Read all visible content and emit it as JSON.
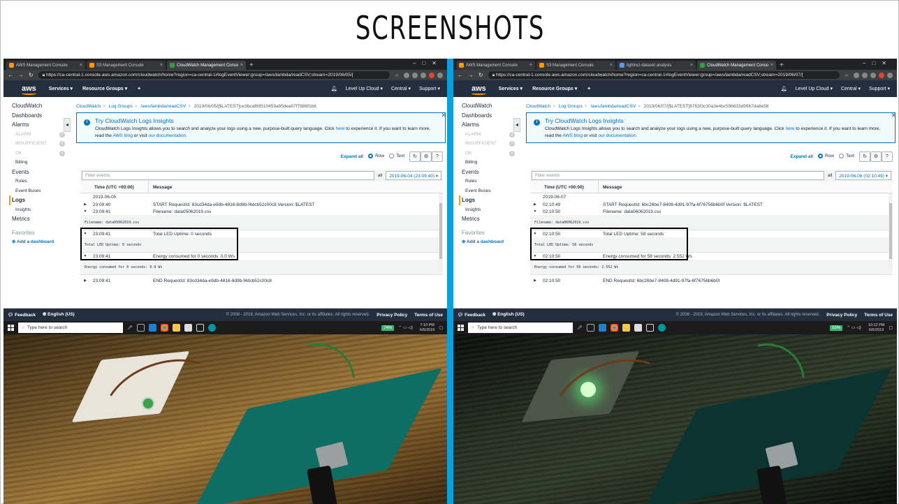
{
  "slide": {
    "title": "SCREENSHOTS"
  },
  "left": {
    "tabs": [
      {
        "label": "AWS Management Console",
        "active": false
      },
      {
        "label": "S3 Management Console",
        "active": false
      },
      {
        "label": "CloudWatch Management Conso",
        "active": true
      }
    ],
    "url": "https://ca-central-1.console.aws.amazon.com/cloudwatch/home?region=ca-central-1#logEventViewer:group=/aws/lambda/readCSV;stream=2019/06/05/[",
    "breadcrumb": {
      "cw": "CloudWatch",
      "lg": "Log Groups",
      "fn": "/aws/lambda/readCSV",
      "stream": "2019/06/05/[$LATEST]ce3bcaf69510459a95dea07f7886f1b6"
    },
    "date_filter": "2019-06-04 (23:09:40)",
    "date_row": "2019-06-05",
    "rows": [
      {
        "toggle": "▶",
        "time": "23:09:40",
        "msg": "START RequestId: 83cd34da-e9db-4816-8d9b-f4dcb52c00c8 Version: $LATEST"
      },
      {
        "toggle": "▼",
        "time": "23:09:41",
        "msg": "Filename: data05062019.csv"
      }
    ],
    "detail1": "Filename: data05062019.csv",
    "hl_row1": {
      "time": "23:09:41",
      "msg": "Total LED Uptime: 0 seconds"
    },
    "detail2": "Total LED Uptime: 0 seconds",
    "hl_row2": {
      "time": "23:09:41",
      "msg": "Energy consumed for 0 seconds: 0.0 Ws"
    },
    "detail3": "Energy consumed for 0 seconds: 0.0 Ws",
    "end_row": {
      "time": "23:09:41",
      "msg": "END RequestId: 83cd34da-e9db-4816-8d9b-f4dcb52c00c8"
    },
    "battery": "74%",
    "time": "7:10 PM",
    "date": "6/5/2019"
  },
  "right": {
    "tabs": [
      {
        "label": "AWS Management Console",
        "active": false
      },
      {
        "label": "S3 Management Console",
        "active": false
      },
      {
        "label": "lightrez-dataset analysis",
        "active": false
      },
      {
        "label": "CloudWatch Management Conso",
        "active": true
      }
    ],
    "url": "https://ca-central-1.console.aws.amazon.com/cloudwatch/home?region=ca-central-1#logEventViewer:group=/aws/lambda/readCSV;stream=2019/06/07/[",
    "breadcrumb": {
      "cw": "CloudWatch",
      "lg": "Log Groups",
      "fn": "/aws/lambda/readCSV",
      "stream": "2019/06/07/[$LATEST]8763f3c30a3e4bc596633d9967da8e58"
    },
    "date_filter": "2019-06-06 (02:10:49)",
    "date_row": "2019-06-07",
    "rows": [
      {
        "toggle": "▶",
        "time": "02:10:49",
        "msg": "START RequestId: 6bc26be7-8408-4d91-97fa-6f76756b6b0f Version: $LATEST"
      },
      {
        "toggle": "▼",
        "time": "02:10:50",
        "msg": "Filename: data06062019.csv"
      }
    ],
    "detail1": "Filename: data06062019.csv",
    "hl_row1": {
      "time": "02:10:50",
      "msg": "Total LED Uptime: 58 seconds"
    },
    "detail2": "Total LED Uptime: 58 seconds",
    "hl_row2": {
      "time": "02:10:50",
      "msg": "Energy consumed for 58 seconds: 2.552 Ws"
    },
    "detail3": "Energy consumed for 58 seconds: 2.552 Ws",
    "end_row": {
      "time": "02:10:50",
      "msg": "END RequestId: 6bc26be7-8408-4d91-97fa-6f76756b6b0f"
    },
    "battery": "55%",
    "time": "10:12 PM",
    "date": "6/6/2019"
  },
  "common": {
    "aws_logo": "aws",
    "services": "Services ▾",
    "resource_groups": "Resource Groups ▾",
    "account": "Level Up Cloud ▾",
    "region": "Central ▾",
    "support": "Support ▾",
    "side": {
      "cloudwatch": "CloudWatch",
      "dashboards": "Dashboards",
      "alarms": "Alarms",
      "alarm": "ALARM",
      "insufficient": "INSUFFICIENT",
      "ok": "OK",
      "zero": "0",
      "billing": "Billing",
      "events": "Events",
      "rules": "Rules",
      "buses": "Event Buses",
      "logs": "Logs",
      "insights": "Insights",
      "metrics": "Metrics",
      "favorites": "Favorites",
      "add_dashboard": "Add a dashboard"
    },
    "info": {
      "title": "Try CloudWatch Logs Insights",
      "text1": "CloudWatch Logs Insights allows you to search and analyze your logs using a new, purpose-built query language. Click",
      "here": "here",
      "text2": "to experience it. If you want to learn more, read the",
      "blog": "AWS blog",
      "text3": "or visit",
      "docs": "our documentation."
    },
    "expand_all": "Expand all",
    "row_label": "Row",
    "text_label": "Text",
    "filter_placeholder": "Filter events",
    "all": "all",
    "col_time": "Time (UTC +00:00)",
    "col_msg": "Message",
    "feedback": "Feedback",
    "language": "English (US)",
    "copyright": "© 2008 - 2019, Amazon Web Services, Inc. or its affiliates. All rights reserved.",
    "privacy": "Privacy Policy",
    "terms": "Terms of Use",
    "taskbar_search": "Type here to search"
  },
  "colors": {
    "divider": "#0aa0dc",
    "aws_nav": "#232f3e",
    "accent": "#ff9900",
    "link": "#0073bb"
  }
}
